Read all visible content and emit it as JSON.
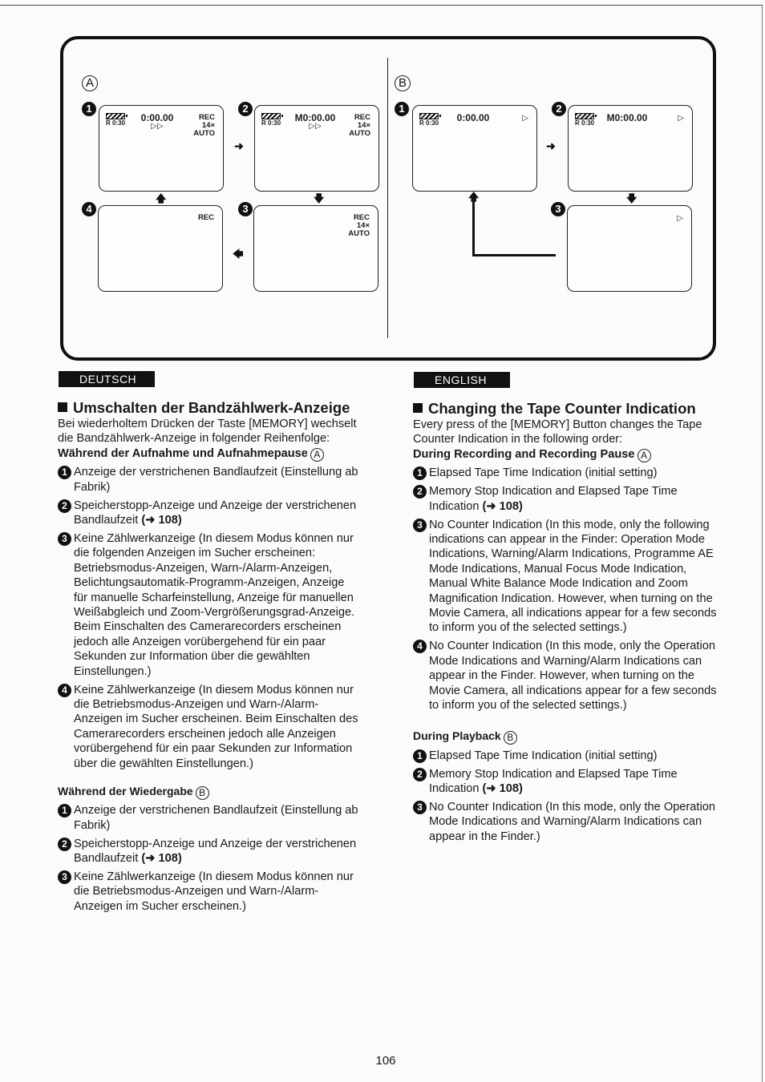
{
  "diagram": {
    "panel_a": {
      "label": "A",
      "screens": [
        {
          "num": "1",
          "remain": "R 0:30",
          "counter": "0:00.00",
          "play": "▷▷",
          "right": [
            "REC",
            "14×",
            "AUTO"
          ]
        },
        {
          "num": "2",
          "remain": "R 0:30",
          "counter": "M0:00.00",
          "play": "▷▷",
          "right": [
            "REC",
            "14×",
            "AUTO"
          ]
        },
        {
          "num": "3",
          "remain": "",
          "counter": "",
          "play": "",
          "right": [
            "REC",
            "14×",
            "AUTO"
          ]
        },
        {
          "num": "4",
          "remain": "",
          "counter": "",
          "play": "",
          "right": [
            "REC"
          ]
        }
      ],
      "arrows": {
        "right": "➜",
        "down": "🡇",
        "left": "🡄",
        "up": "🡅"
      }
    },
    "panel_b": {
      "label": "B",
      "screens": [
        {
          "num": "1",
          "remain": "R 0:30",
          "counter": "0:00.00",
          "tri": "▷"
        },
        {
          "num": "2",
          "remain": "R 0:30",
          "counter": "M0:00.00",
          "tri": "▷"
        },
        {
          "num": "3",
          "remain": "",
          "counter": "",
          "tri": "▷"
        }
      ]
    }
  },
  "deutsch": {
    "lang_tag": "DEUTSCH",
    "title": "Umschalten der Bandzählwerk-Anzeige",
    "intro": "Bei wiederholtem Drücken der Taste [MEMORY] wechselt die Bandzählwerk-Anzeige in folgender Reihenfolge:",
    "rec_heading": "Während der Aufnahme und Aufnahmepause",
    "rec_heading_mark": "A",
    "rec_items": [
      {
        "num": "1",
        "text": "Anzeige der verstrichenen Bandlaufzeit (Einstellung ab Fabrik)",
        "ref": ""
      },
      {
        "num": "2",
        "text": "Speicherstopp-Anzeige und Anzeige der verstrichenen Bandlaufzeit ",
        "ref": "(➜ 108)"
      },
      {
        "num": "3",
        "text": "Keine Zählwerkanzeige (In diesem Modus können nur die folgenden Anzeigen im Sucher erscheinen: Betriebsmodus-Anzeigen, Warn-/Alarm-Anzeigen, Belichtungsautomatik-Programm-Anzeigen, Anzeige für manuelle Scharfeinstellung, Anzeige für manuellen Weißabgleich und Zoom-Vergrößerungsgrad-Anzeige. Beim Einschalten des Camerarecorders erscheinen jedoch alle Anzeigen vorübergehend für ein paar Sekunden zur Information über die gewählten Einstellungen.)",
        "ref": ""
      },
      {
        "num": "4",
        "text": "Keine Zählwerkanzeige (In diesem Modus können nur die Betriebsmodus-Anzeigen und Warn-/Alarm-Anzeigen im Sucher erscheinen. Beim Einschalten des Camerarecorders erscheinen jedoch alle Anzeigen vorübergehend für ein paar Sekunden zur Information über die gewählten Einstellungen.)",
        "ref": ""
      }
    ],
    "play_heading": "Während der Wiedergabe",
    "play_heading_mark": "B",
    "play_items": [
      {
        "num": "1",
        "text": "Anzeige der verstrichenen Bandlaufzeit (Einstellung ab Fabrik)",
        "ref": ""
      },
      {
        "num": "2",
        "text": "Speicherstopp-Anzeige und Anzeige der verstrichenen Bandlaufzeit ",
        "ref": "(➜ 108)"
      },
      {
        "num": "3",
        "text": "Keine Zählwerkanzeige (In diesem Modus können nur die Betriebsmodus-Anzeigen und Warn-/Alarm-Anzeigen im Sucher erscheinen.)",
        "ref": ""
      }
    ]
  },
  "english": {
    "lang_tag": "ENGLISH",
    "title": "Changing the Tape Counter Indication",
    "intro": "Every press of the [MEMORY] Button changes the Tape Counter Indication in the following order:",
    "rec_heading": "During Recording and Recording Pause",
    "rec_heading_mark": "A",
    "rec_items": [
      {
        "num": "1",
        "text": "Elapsed Tape Time Indication (initial setting)",
        "ref": ""
      },
      {
        "num": "2",
        "text": "Memory Stop Indication and Elapsed Tape Time Indication ",
        "ref": "(➜ 108)"
      },
      {
        "num": "3",
        "text": "No Counter Indication (In this mode, only the following indications can appear in the Finder: Operation Mode Indications, Warning/Alarm Indications, Programme AE Mode Indications, Manual Focus Mode Indication, Manual White Balance Mode Indication and Zoom Magnification Indication. However, when turning on the Movie Camera, all indications appear for a few seconds to inform you of the selected settings.)",
        "ref": ""
      },
      {
        "num": "4",
        "text": "No Counter Indication (In this mode, only the Operation Mode Indications and Warning/Alarm Indications can appear in the Finder. However, when turning on the Movie Camera, all indications appear for a few seconds to inform you of the selected settings.)",
        "ref": ""
      }
    ],
    "play_heading": "During Playback",
    "play_heading_mark": "B",
    "play_items": [
      {
        "num": "1",
        "text": "Elapsed Tape Time Indication (initial setting)",
        "ref": ""
      },
      {
        "num": "2",
        "text": "Memory Stop Indication and Elapsed Tape Time Indication ",
        "ref": "(➜ 108)"
      },
      {
        "num": "3",
        "text": "No Counter Indication (In this mode, only the Operation Mode Indications and Warning/Alarm Indications can appear in the Finder.)",
        "ref": ""
      }
    ]
  },
  "page_number": "106"
}
